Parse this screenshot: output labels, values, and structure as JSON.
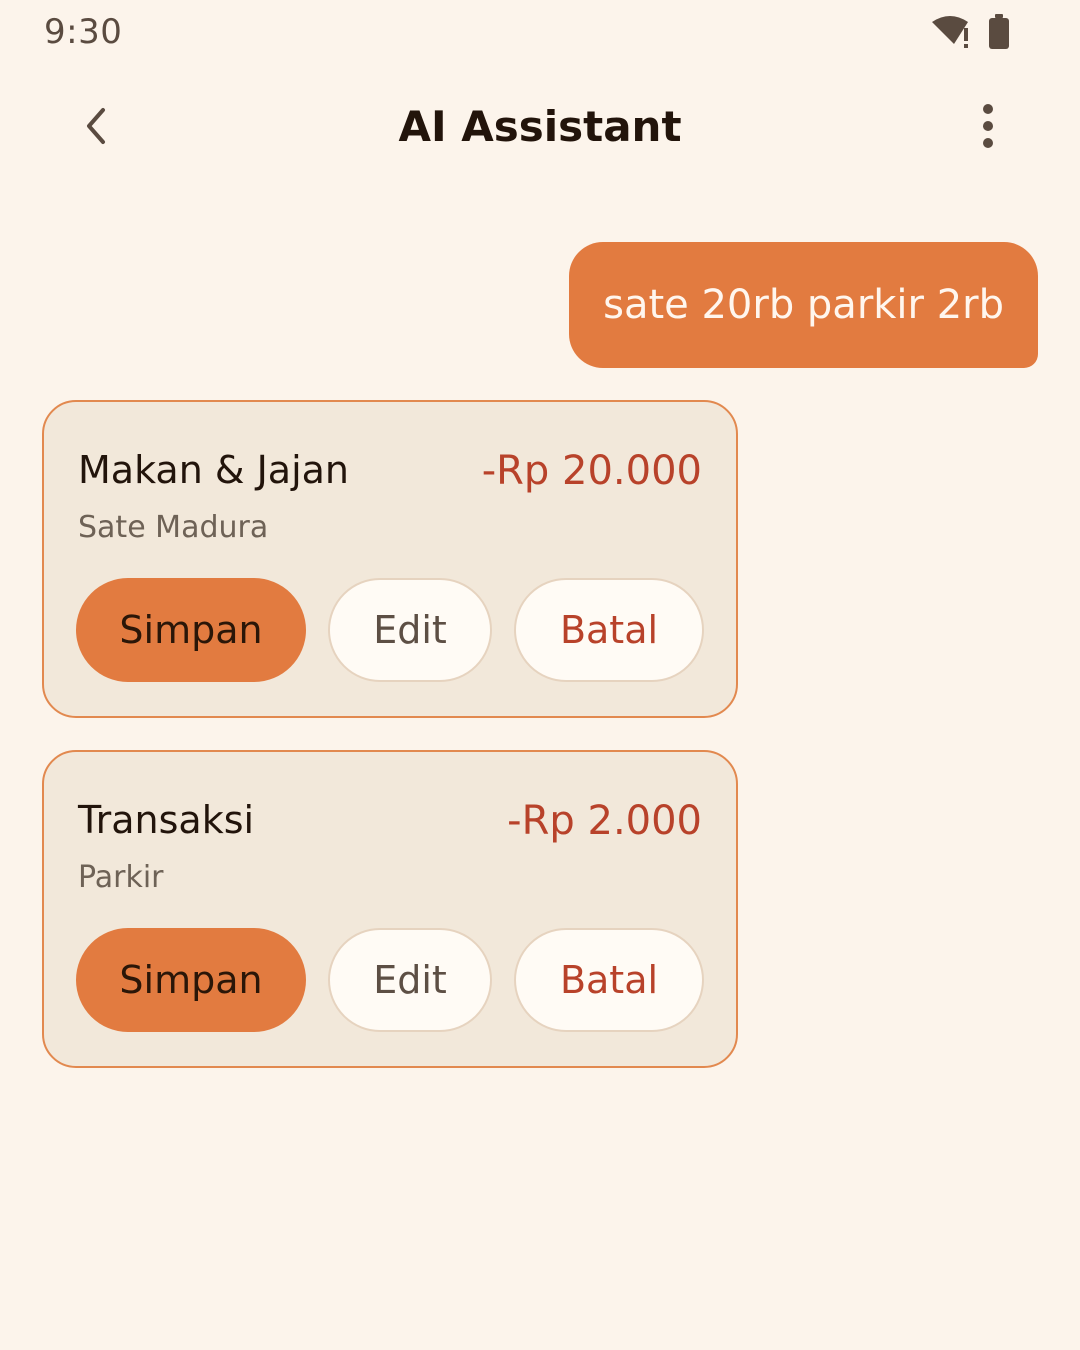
{
  "status_bar": {
    "time": "9:30",
    "icons": [
      "wifi-warning-icon",
      "battery-icon"
    ]
  },
  "header": {
    "title": "AI Assistant",
    "back_icon": "chevron-left-icon",
    "menu_icon": "more-vertical-icon"
  },
  "chat": {
    "user_message": "sate 20rb parkir 2rb",
    "transactions": [
      {
        "category": "Makan & Jajan",
        "description": "Sate Madura",
        "amount": "-Rp 20.000",
        "save_label": "Simpan",
        "edit_label": "Edit",
        "cancel_label": "Batal"
      },
      {
        "category": "Transaksi",
        "description": "Parkir",
        "amount": "-Rp 2.000",
        "save_label": "Simpan",
        "edit_label": "Edit",
        "cancel_label": "Batal"
      }
    ]
  },
  "colors": {
    "background": "#FCF4EB",
    "accent": "#E27B40",
    "card_background": "#F2E8DA",
    "negative_amount": "#B8422A"
  }
}
